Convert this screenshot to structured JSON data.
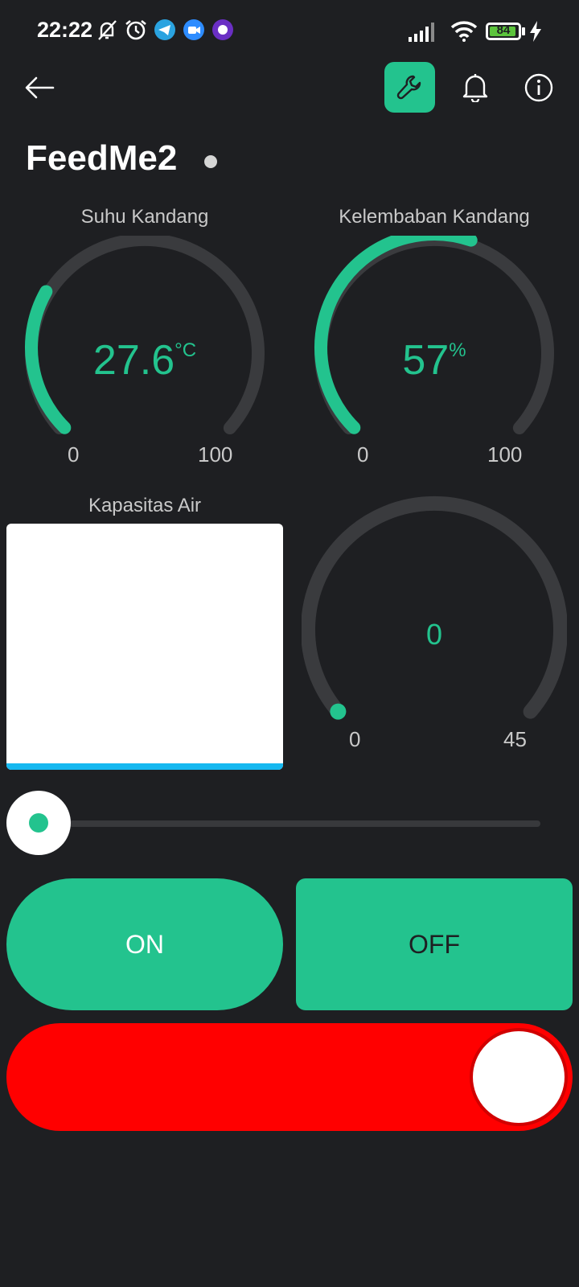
{
  "status_bar": {
    "time": "22:22",
    "battery": "84",
    "icons": [
      "mute-bell-icon",
      "alarm-icon",
      "telegram-icon",
      "video-call-icon",
      "app-icon",
      "signal-icon",
      "wifi-icon",
      "battery-icon",
      "charging-icon"
    ]
  },
  "header": {
    "title": "FeedMe2",
    "icons": [
      "back-arrow-icon",
      "wrench-icon",
      "bell-icon",
      "info-icon"
    ]
  },
  "colors": {
    "accent": "#23c38e",
    "background": "#1e1f22",
    "toggle_on": "#ff0000",
    "water": "#16b8f0"
  },
  "gauges": [
    {
      "title": "Suhu Kandang",
      "value": "27.6",
      "unit": "°C",
      "min": "0",
      "max": "100",
      "level": 27.6
    },
    {
      "title": "Kelembaban Kandang",
      "value": "57",
      "unit": "%",
      "min": "0",
      "max": "100",
      "level": 57
    },
    {
      "title": "",
      "value": "0",
      "unit": "",
      "min": "0",
      "max": "45",
      "level": 0
    }
  ],
  "water_tank": {
    "title": "Kapasitas Air",
    "level_percent": 3
  },
  "slider": {
    "value_percent": 0
  },
  "buttons": {
    "on_label": "ON",
    "off_label": "OFF"
  },
  "toggle": {
    "state": "on"
  }
}
